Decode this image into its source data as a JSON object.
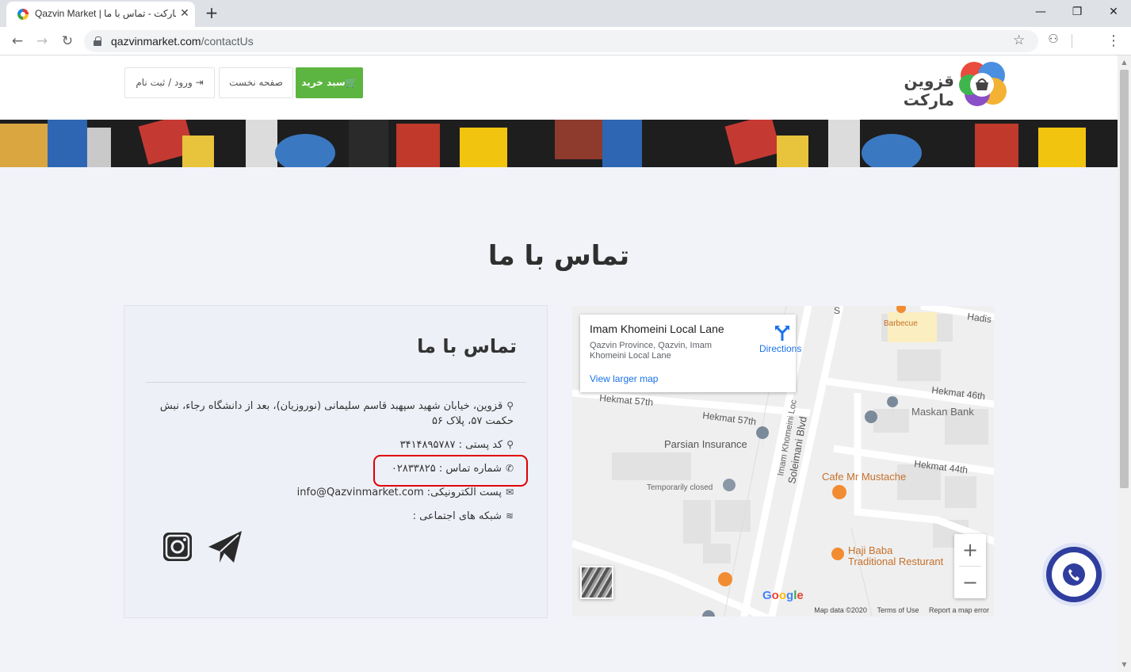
{
  "browser": {
    "tab_title": "Qazvin Market | قزوین مارکت - تماس با ما",
    "tab_close": "✕",
    "new_tab": "+",
    "url_host": "qazvinmarket.com",
    "url_path": "/contactUs",
    "window": {
      "minimize": "—",
      "maximize": "❐",
      "close": "✕"
    }
  },
  "header": {
    "logo_text": "قزوین مارکت",
    "cart_button": "🛒سبد خرید",
    "home_button": "صفحه نخست",
    "login_button": "ورود / ثبت نام"
  },
  "page": {
    "title": "تماس با ما"
  },
  "contact": {
    "title": "تماس با ما",
    "address": "قزوین، خیابان شهید سپهبد قاسم سلیمانی (نوروزیان)، بعد از دانشگاه رجاء، نبش حکمت ۵۷، پلاک ۵۶",
    "postal": "کد پستی : ۳۴۱۴۸۹۵۷۸۷",
    "phone": "شماره تماس : ۰۲۸۳۳۸۲۵",
    "email": "پست الکترونیکی: info@Qazvinmarket.com",
    "social": "شبکه های اجتماعی :"
  },
  "map": {
    "place_name": "Imam Khomeini Local Lane",
    "place_address": "Qazvin Province, Qazvin, Imam Khomeini Local Lane",
    "directions": "Directions",
    "larger_map": "View larger map",
    "zoom_in": "+",
    "zoom_out": "−",
    "map_data": "Map data ©2020",
    "terms": "Terms of Use",
    "report": "Report a map error",
    "google": "Google",
    "labels": {
      "barbecue": "Barbecue",
      "hadis": "Hadis",
      "hekmat46": "Hekmat 46th",
      "maskan": "Maskan Bank",
      "hekmat57a": "Hekmat 57th",
      "hekmat57b": "Hekmat 57th",
      "parsian": "Parsian Insurance",
      "hekmat44": "Hekmat 44th",
      "soleimani": "Soleimani Blvd",
      "imamlane": "Imam Khomeini Loc",
      "temp_closed": "Temporarily closed",
      "cafe": "Cafe Mr Mustache",
      "haji1": "Haji Baba",
      "haji2": "Traditional Resturant",
      "s": "S"
    }
  },
  "colors": {
    "cart_green": "#5cb540",
    "highlight_red": "#e00000",
    "fab_blue": "#2f3e9e",
    "link_blue": "#1a73e8"
  }
}
